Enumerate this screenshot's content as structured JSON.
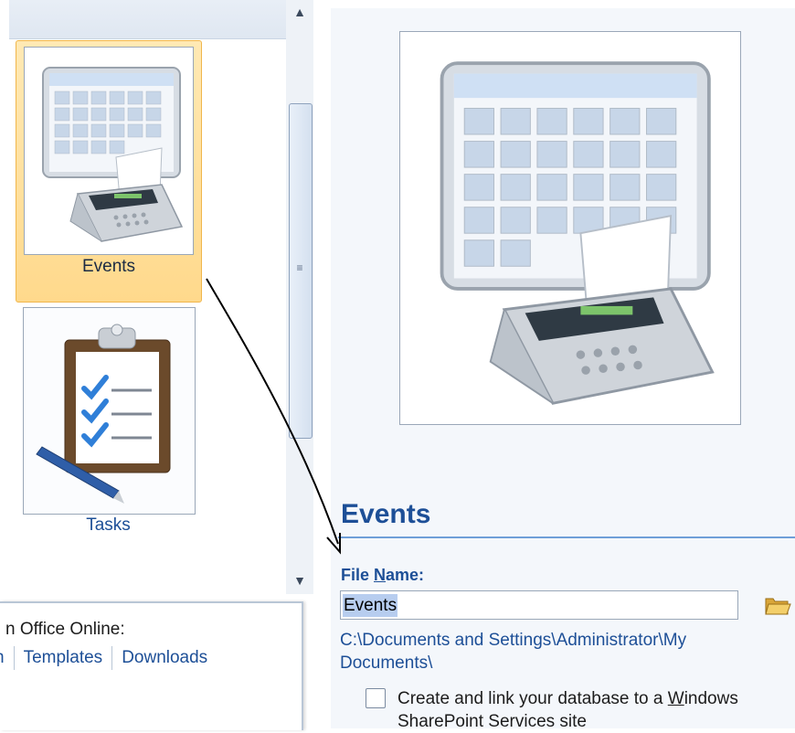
{
  "gallery": {
    "templates": [
      {
        "label": "Events",
        "selected": true
      },
      {
        "label": "Tasks",
        "selected": false
      }
    ]
  },
  "online": {
    "title": "n Office Online:",
    "link_partial": "n",
    "links": [
      "Templates",
      "Downloads"
    ]
  },
  "preview": {
    "title": "Events",
    "file_name_label_pre": "File ",
    "file_name_label_u": "N",
    "file_name_label_post": "ame:",
    "file_name_value": "Events",
    "save_path": "C:\\Documents and Settings\\Administrator\\My Documents\\",
    "sharepoint_pre": "Create and link your database to a ",
    "sharepoint_u": "W",
    "sharepoint_post": "indows SharePoint Services site",
    "sharepoint_checked": false
  },
  "colors": {
    "accent": "#1d4f97",
    "selection": "#ffd98c",
    "rule": "#6f9fd8"
  },
  "icons": [
    "calendar-fax-icon",
    "clipboard-checklist-icon",
    "folder-open-icon",
    "arrow-up-icon",
    "arrow-down-icon",
    "grip-icon"
  ]
}
